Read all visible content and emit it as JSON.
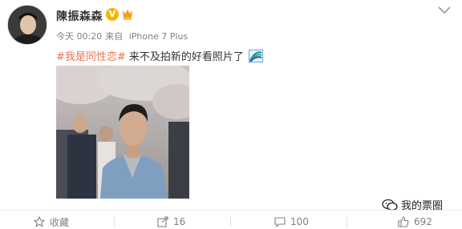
{
  "post": {
    "author": "陳振森森",
    "time": "今天 00:20",
    "source_prefix": "来自",
    "source_device": "iPhone 7 Plus",
    "verified_mark": "V",
    "topic": "#我是同性恋#",
    "text": " 来不及拍新的好看照片了",
    "emoji_name": "rainbow-sticker-icon"
  },
  "actions": {
    "favorite_label": "收藏",
    "share_count": "16",
    "comment_count": "100",
    "like_count": "692"
  },
  "watermark": {
    "text": "我的票圈"
  },
  "colors": {
    "topic": "#eb7350",
    "verified": "#f7b500",
    "meta": "#808080"
  }
}
